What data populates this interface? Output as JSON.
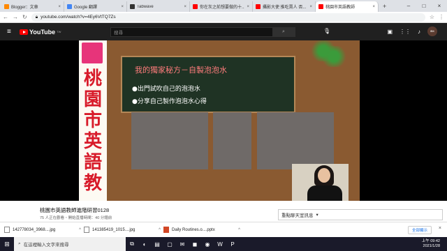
{
  "browser": {
    "tabs": [
      {
        "title": "Blogger：文章",
        "fav": "#ff8800",
        "active": false
      },
      {
        "title": "Google 翻譯",
        "fav": "#4285f4",
        "active": false
      },
      {
        "title": "Tabwave",
        "fav": "#333333",
        "active": false
      },
      {
        "title": "你在灰之前想要做的十...",
        "fav": "#ff0000",
        "active": false
      },
      {
        "title": "攝影大使 推吃賣人 否...",
        "fav": "#ff0000",
        "active": false
      },
      {
        "title": "桃園市英語教師",
        "fav": "#ff0000",
        "active": true
      }
    ],
    "new_tab": "+",
    "url": "youtube.com/watch?v=4Ey6VtTQ7Zs"
  },
  "youtube": {
    "logo_text": "YouTube",
    "logo_sup": "TW",
    "search_placeholder": "搜尋",
    "avatar_text": "IBK"
  },
  "video": {
    "vertical_title": "桃園市英語教",
    "board_heading": "我的獨家秘方－自製泡泡水",
    "board_lines": [
      "●出門試吹自己的泡泡水",
      "●分享自己製作泡泡水心得"
    ]
  },
  "below": {
    "title": "桃園市英語教師進階研習0128",
    "meta": "75 人正在觀看・開始直播時間：40 分鐘前",
    "chat_label": "重點聊天室訊息",
    "chat_chevron": "▾"
  },
  "downloads": {
    "items": [
      {
        "name": "142778034_3968....jpg"
      },
      {
        "name": "141385419_1015....jpg"
      },
      {
        "name": "Daily Routines.o....pptx"
      }
    ],
    "show_all": "全部顯示",
    "close": "×"
  },
  "taskbar": {
    "search_placeholder": "在這裡輸入文字來搜尋",
    "time": "上午 09:42",
    "date": "2021/1/28"
  }
}
